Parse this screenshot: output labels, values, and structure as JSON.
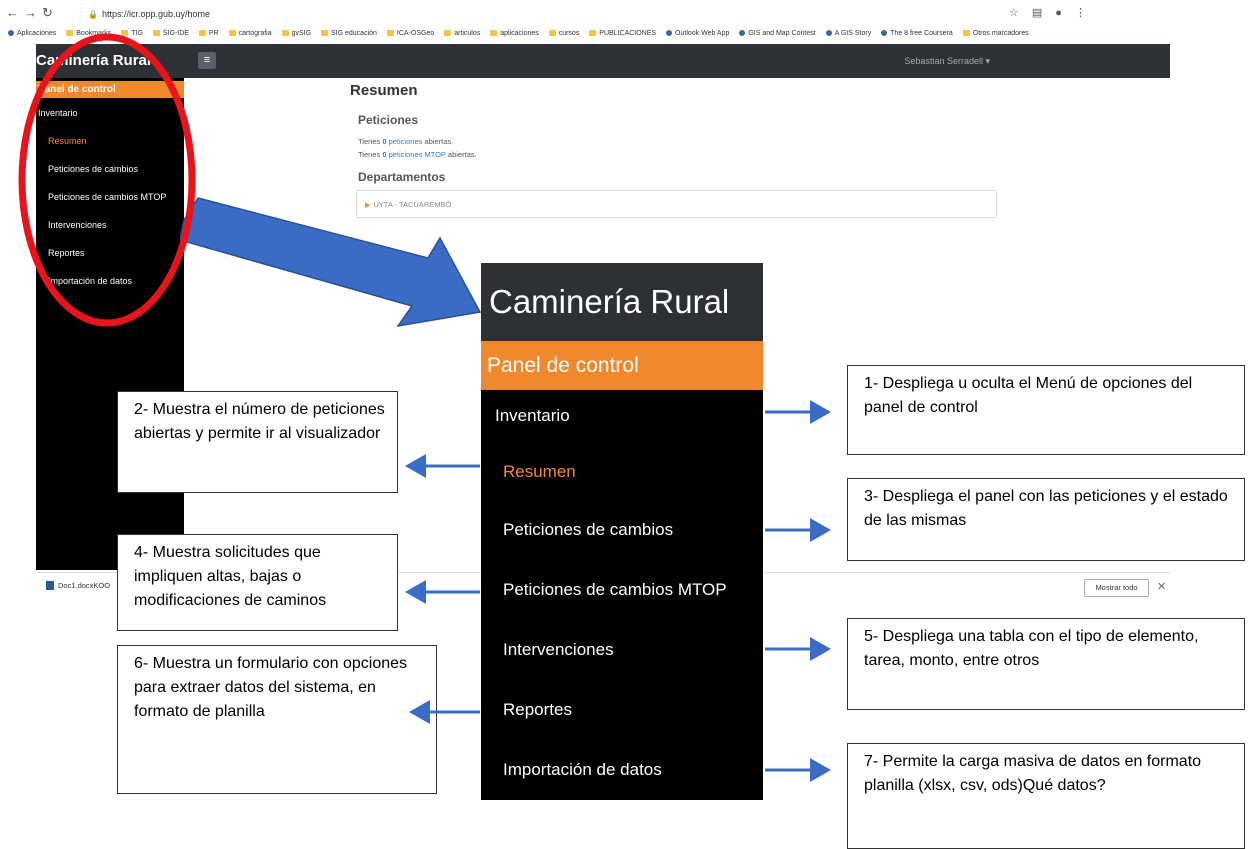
{
  "browser": {
    "url": "https://icr.opp.gub.uy/home",
    "bookmarks": [
      "Aplicaciones",
      "Bookmarks",
      "TIG",
      "SIG-IDE",
      "PR",
      "cartografia",
      "gvSIG",
      "SIG educación",
      "ICA-OSGeo",
      "articulos",
      "aplicaciones",
      "cursos",
      "PUBLICACIONES",
      "Outlook Web App",
      "GIS and Map Contest",
      "A GIS Story",
      "The 8 free Coursera",
      "Otros marcadores"
    ]
  },
  "app": {
    "title": "Caminería Rural",
    "user": "Sebastian Serradell ▾"
  },
  "sidebar": {
    "panel": "Panel de control",
    "items": [
      {
        "label": "Inventario"
      },
      {
        "label": "Resumen"
      },
      {
        "label": "Peticiones de cambios"
      },
      {
        "label": "Peticiones de cambios MTOP"
      },
      {
        "label": "Intervenciones"
      },
      {
        "label": "Reportes"
      },
      {
        "label": "Importación de datos"
      }
    ]
  },
  "main": {
    "title": "Resumen",
    "peticiones_title": "Peticiones",
    "line1": {
      "pre": "Tienes ",
      "count": "0",
      "link": "peticiones",
      "post": " abiertas."
    },
    "line2": {
      "pre": "Tienes ",
      "count": "0",
      "link": "peticiones MTOP",
      "post": " abiertas."
    },
    "departamentos_title": "Departamentos",
    "departamento": "UYTA - TACUAREMBÓ"
  },
  "downloads": {
    "file": "Doc1.docxKOO",
    "show_all": "Mostrar todo",
    "close": "✕"
  },
  "annotations": {
    "a1": "1- Despliega u oculta el Menú de opciones del panel de control",
    "a2": "2- Muestra el número de peticiones abiertas y permite ir al visualizador",
    "a3": "3- Despliega el panel con las peticiones y el estado de las mismas",
    "a4": "4- Muestra solicitudes que impliquen altas, bajas o modificaciones de caminos",
    "a5": "5- Despliega una tabla con el tipo de elemento, tarea, monto, entre otros",
    "a6": "6- Muestra un formulario con opciones para extraer datos del sistema, en formato de planilla",
    "a7": "7- Permite la carga masiva de datos en formato planilla (xlsx, csv, ods)Qué datos?"
  },
  "colors": {
    "accent": "#f0882d",
    "header": "#2d3035",
    "highlight_ellipse": "#e8141b",
    "arrow": "#3b6cc5"
  }
}
